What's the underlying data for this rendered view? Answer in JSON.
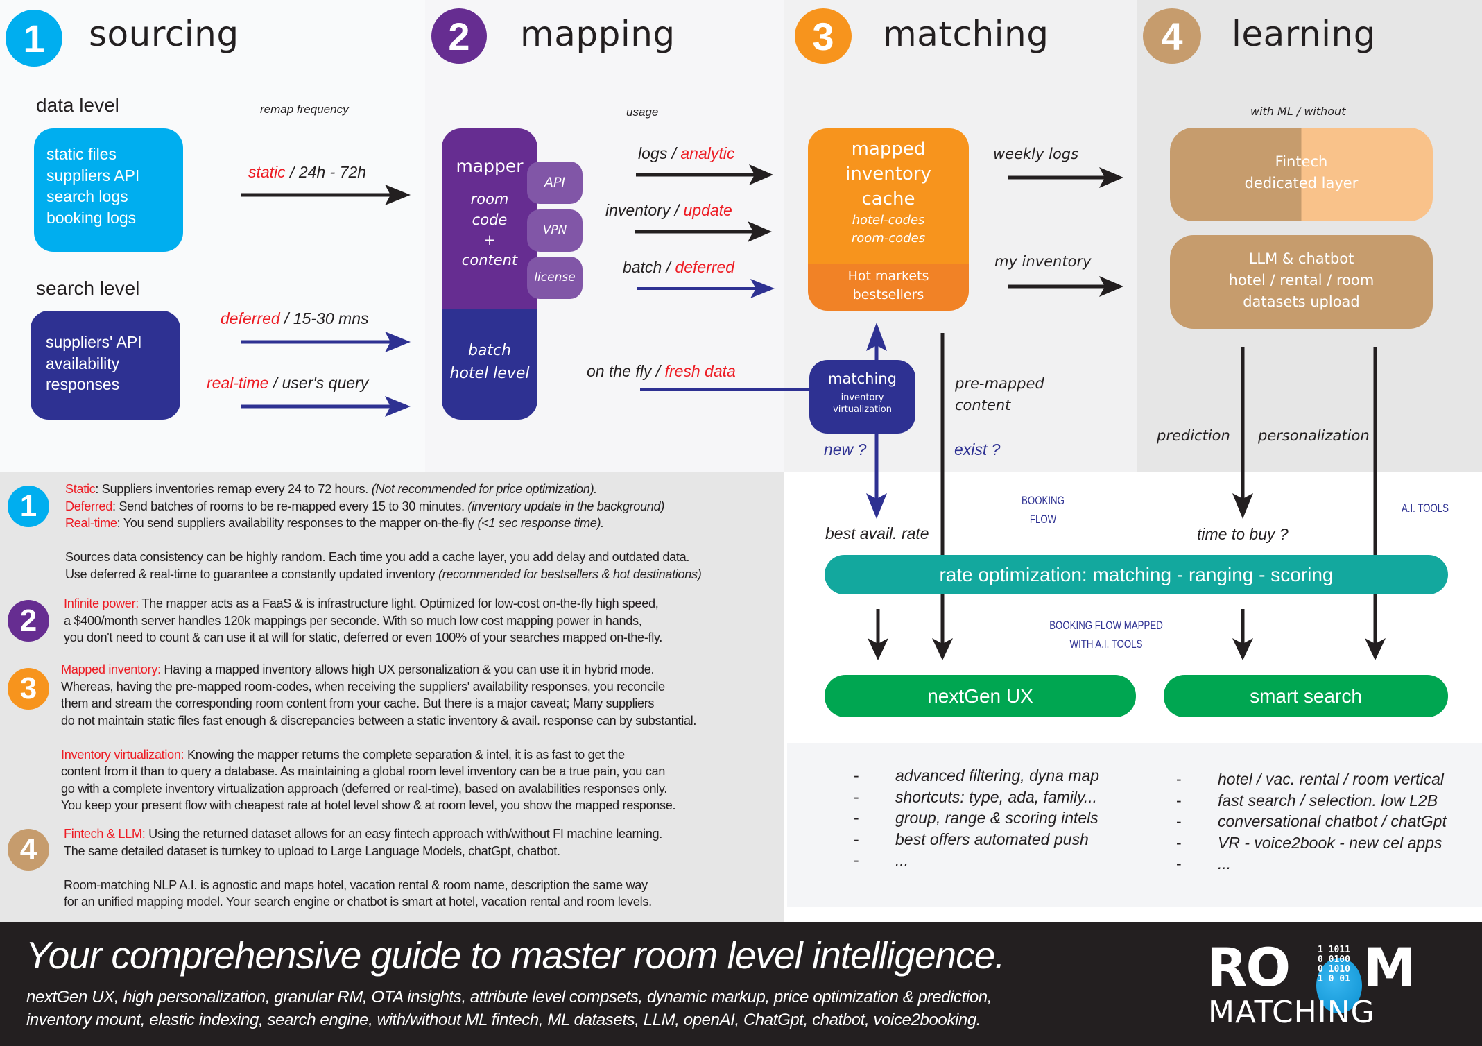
{
  "colors": {
    "sourcing": "#00aeef",
    "mapping": "#662d91",
    "matching": "#f7941d",
    "learning": "#c69c6d",
    "navy": "#2e3192",
    "red": "#ed1c24",
    "teal": "#13a89e",
    "green": "#00a651",
    "footer_bg": "#231f20"
  },
  "sections": [
    {
      "number": "1",
      "title": "sourcing"
    },
    {
      "number": "2",
      "title": "mapping"
    },
    {
      "number": "3",
      "title": "matching"
    },
    {
      "number": "4",
      "title": "learning"
    }
  ],
  "sourcing": {
    "data_level_label": "data level",
    "data_level_items": [
      "static files",
      "suppliers API",
      "search logs",
      "booking logs"
    ],
    "search_level_label": "search level",
    "search_level_items": [
      "suppliers' API",
      "availability",
      "responses"
    ],
    "remap_frequency_label": "remap frequency",
    "flows": [
      {
        "key": "static",
        "rest": " / 24h - 72h"
      },
      {
        "key": "deferred",
        "rest": " / 15-30 mns"
      },
      {
        "key": "real-time",
        "rest": " / user's query"
      }
    ]
  },
  "mapping": {
    "mapper_title": "mapper",
    "mapper_body": [
      "room",
      "code",
      "+",
      "content"
    ],
    "tabs": [
      "API",
      "VPN",
      "license"
    ],
    "lower": [
      "batch",
      "hotel level"
    ],
    "usage_label": "usage",
    "usages": [
      {
        "key": "logs",
        "value": "analytic"
      },
      {
        "key": "inventory",
        "value": "update"
      },
      {
        "key": "batch",
        "value": "deferred"
      },
      {
        "key": "on the fly",
        "value": "fresh data"
      }
    ]
  },
  "matching": {
    "cache_title": [
      "mapped",
      "inventory",
      "cache"
    ],
    "cache_codes": [
      "hotel-codes",
      "room-codes"
    ],
    "cache_hot": [
      "Hot markets",
      "bestsellers"
    ],
    "virt_title": "matching",
    "virt_sub": [
      "inventory",
      "virtualization"
    ],
    "weekly_logs": "weekly logs",
    "my_inventory": "my inventory",
    "pre_mapped": [
      "pre-mapped",
      "content"
    ],
    "new_q": "new ?",
    "exist_q": "exist ?"
  },
  "learning": {
    "with_ml": "with ML / without",
    "fintech": [
      "Fintech",
      "dedicated layer"
    ],
    "llm": [
      "LLM & chatbot",
      "hotel / rental / room",
      "datasets upload"
    ],
    "prediction": "prediction",
    "personalization": "personalization"
  },
  "flow": {
    "best_avail_rate": "best avail. rate",
    "booking_flow": [
      "BOOKING",
      "FLOW"
    ],
    "time_to_buy": "time to buy ?",
    "ai_tools": "A.I. TOOLS",
    "rate_optimization": "rate optimization: matching - ranging - scoring",
    "booking_flow_mapped": [
      "BOOKING FLOW MAPPED",
      "WITH A.I. TOOLS"
    ],
    "nextgen_ux": "nextGen UX",
    "smart_search": "smart search"
  },
  "nextgen_list": [
    "advanced filtering, dyna map",
    "shortcuts: type, ada, family...",
    "group, range & scoring intels",
    "best offers automated push",
    "..."
  ],
  "smart_list": [
    "hotel / vac. rental / room vertical",
    "fast search / selection. low L2B",
    "conversational chatbot / chatGpt",
    "VR - voice2book - new cel apps",
    "..."
  ],
  "notes": {
    "n1": [
      {
        "key": "Static",
        "text": ": Suppliers inventories remap every 24 to 72 hours. ",
        "italic": "(Not recommended for price optimization)."
      },
      {
        "key": "Deferred",
        "text": ": Send batches of rooms to be re-mapped every 15 to 30 minutes. ",
        "italic": "(inventory update in the background)"
      },
      {
        "key": "Real-time",
        "text": ": You send suppliers availability responses to the mapper on-the-fly ",
        "italic": "(<1 sec response time)."
      }
    ],
    "n1_extra": [
      {
        "text": "Sources data consistency can be highly random. Each time you add a cache layer, you add delay and outdated data.",
        "italic": ""
      },
      {
        "text": "Use deferred & real-time to guarantee a constantly updated inventory ",
        "italic": "(recommended for bestsellers  & hot destinations)"
      }
    ],
    "n2_key": "Infinite power:",
    "n2": [
      " The mapper acts as a FaaS & is infrastructure light. Optimized for low-cost on-the-fly high speed,",
      "a $400/month server handles 120k mappings per seconde.  With so much low cost mapping power in hands,",
      "you don't need to count & can use it at will for static, deferred or even 100% of your searches mapped on-the-fly."
    ],
    "n3_key": "Mapped inventory:",
    "n3": [
      " Having a mapped inventory allows high UX personalization & you can use it in hybrid mode.",
      "Whereas, having the pre-mapped room-codes, when receiving the suppliers' availability responses, you reconcile",
      "them and stream the corresponding room content from your cache. But there is a major caveat; Many suppliers",
      "do not maintain static files fast enough & discrepancies between a static inventory & avail. response can by substantial."
    ],
    "n3b_key": "Inventory virtualization:",
    "n3b": [
      " Knowing the mapper returns the complete separation & intel, it is as fast to get the",
      "content from it than to query a database. As maintaining a global room level inventory can be a true pain, you can",
      "go with a complete inventory virtualization approach (deferred or real-time), based on avalabilities responses only.",
      "You keep your present flow with cheapest rate at hotel level show & at room level, you show the mapped response."
    ],
    "n4_key": "Fintech & LLM:",
    "n4": [
      " Using the returned dataset allows for an easy fintech approach with/without FI machine learning.",
      "The same detailed dataset is turnkey to upload to Large Language Models, chatGpt, chatbot."
    ],
    "n4_extra": [
      "Room-matching NLP A.I. is agnostic and maps hotel, vacation rental & room name, description the same way",
      "for an unified mapping model. Your search engine or chatbot is smart at hotel, vacation rental and room levels."
    ]
  },
  "footer": {
    "title": "Your comprehensive guide to master room level intelligence.",
    "lines": [
      "nextGen UX, high personalization, granular RM, OTA insights, attribute level compsets, dynamic markup, price optimization & prediction,",
      "inventory mount, elastic indexing, search engine, with/without ML fintech, ML datasets, LLM, openAI, ChatGpt, chatbot, voice2booking."
    ],
    "logo_top_left": "RO",
    "logo_top_right": "M",
    "logo_bottom": "MATCHING",
    "logo_binary": [
      "1 1011",
      "0 0100",
      "0 1010",
      "1 0  01"
    ]
  }
}
